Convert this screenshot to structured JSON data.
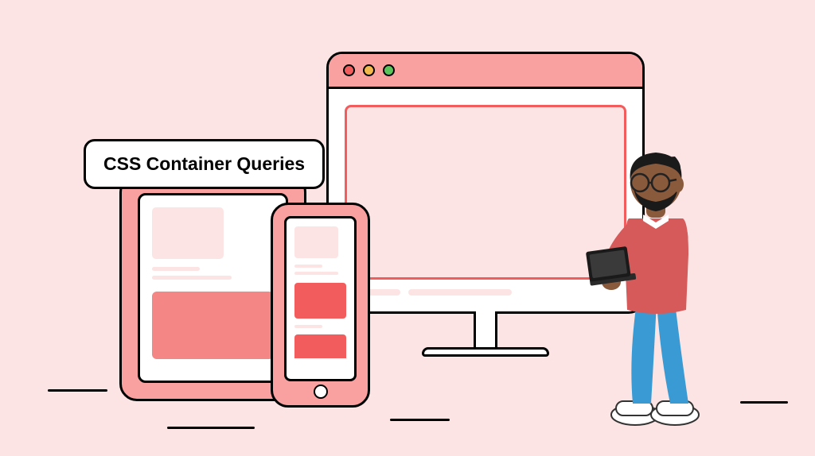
{
  "title": "CSS Container Queries",
  "colors": {
    "background": "#fce4e4",
    "accent_light": "#f9a0a0",
    "accent_mid": "#f58686",
    "accent_dark": "#f25c5c",
    "outline": "#000000",
    "white": "#ffffff"
  },
  "devices": {
    "desktop": {
      "traffic_lights": [
        "red",
        "yellow",
        "green"
      ]
    },
    "tablet": {},
    "phone": {}
  },
  "character": {
    "description": "3D illustrated person holding a laptop",
    "shirt_color": "#d65a5a",
    "pants_color": "#3a9bd4",
    "shoes_color": "#ffffff"
  }
}
